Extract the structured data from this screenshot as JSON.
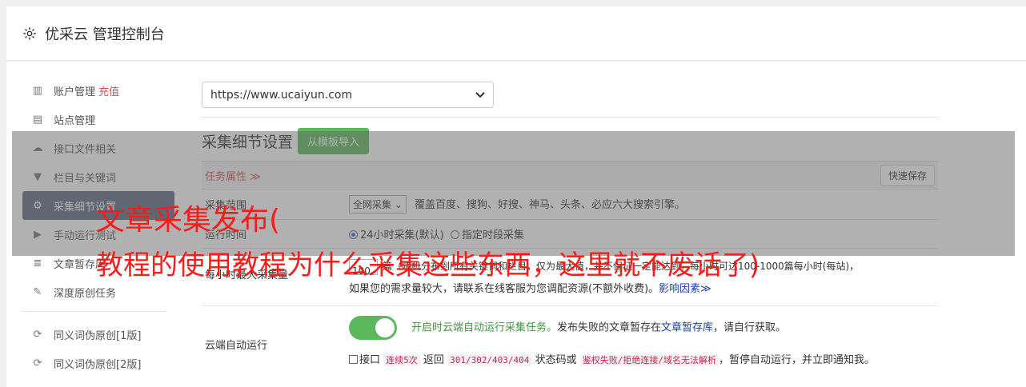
{
  "header": {
    "icon": "gear-icon",
    "title": "优采云 管理控制台"
  },
  "sidebar": {
    "items": [
      {
        "icon": "bar-chart-icon",
        "glyph": "▥",
        "label": "账户管理",
        "badge": "充值"
      },
      {
        "icon": "server-icon",
        "glyph": "▤",
        "label": "站点管理"
      },
      {
        "icon": "cloud-upload-icon",
        "glyph": "☁",
        "label": "接口文件相关"
      },
      {
        "icon": "filter-icon",
        "glyph": "▼",
        "label": "栏目与关键词"
      },
      {
        "icon": "cogs-icon",
        "glyph": "⚙",
        "label": "采集细节设置"
      },
      {
        "icon": "play-circle-icon",
        "glyph": "▶",
        "label": "手动运行测试"
      },
      {
        "icon": "database-icon",
        "glyph": "≣",
        "label": "文章暂存库"
      },
      {
        "icon": "edit-icon",
        "glyph": "✎",
        "label": "深度原创任务"
      },
      {
        "icon": "refresh-icon",
        "glyph": "⟳",
        "label": "同义词伪原创[1版]"
      },
      {
        "icon": "refresh-icon",
        "glyph": "⟳",
        "label": "同义词伪原创[2版]"
      }
    ]
  },
  "content": {
    "site_select": "https://www.ucaiyun.com",
    "section_title": "采集细节设置",
    "import_button": "从模板导入",
    "task_attr_label": "任务属性 ≫",
    "quick_save": "快速保存",
    "rows": {
      "scope": {
        "label": "采集范围",
        "select": "全网采集",
        "desc": "覆盖百度、搜狗、好搜、神马、头条、必应六大搜索引擎。"
      },
      "runtime": {
        "label": "运行时间",
        "opt1": "24小时采集(默认)",
        "opt2": "指定时段采集"
      },
      "max_per_hour": {
        "label": "每小时最大采集量",
        "value": "100",
        "line1_tail": "篇（随机分布到所有关键词和栏目，仅为最大值，并不保证一定能达到。每小时可达100-1000篇每小时(每站)，",
        "line2": "如果您的需求量较大，请联系在线客服为您调配资源(不额外收费)。",
        "link": "影响因素≫"
      },
      "cloud": {
        "label": "云端自动运行",
        "toggle_text": "开启时云端自动运行采集任务。",
        "desc_a": "发布失败的文章暂存在",
        "desc_link": "文章暂存库",
        "desc_b": "，请自行获取。",
        "cb_prefix": "接口",
        "code1": "连续5次",
        "mid1": "返回",
        "code2": "301/302/403/404",
        "mid2": "状态码或",
        "code3": "鉴权失败/拒绝连接/域名无法解析",
        "suffix": "，暂停自动运行，并立即通知我。"
      }
    }
  },
  "overlay": {
    "line1": "文章采集发布(",
    "line2": "教程的使用教程为什么采集这些东西，这里就不废话了)"
  },
  "colors": {
    "active_nav": "#5f6a80",
    "accent_green": "#5cb85c",
    "overlay_text": "#ff1a1a",
    "badge_red": "#d9534f"
  }
}
